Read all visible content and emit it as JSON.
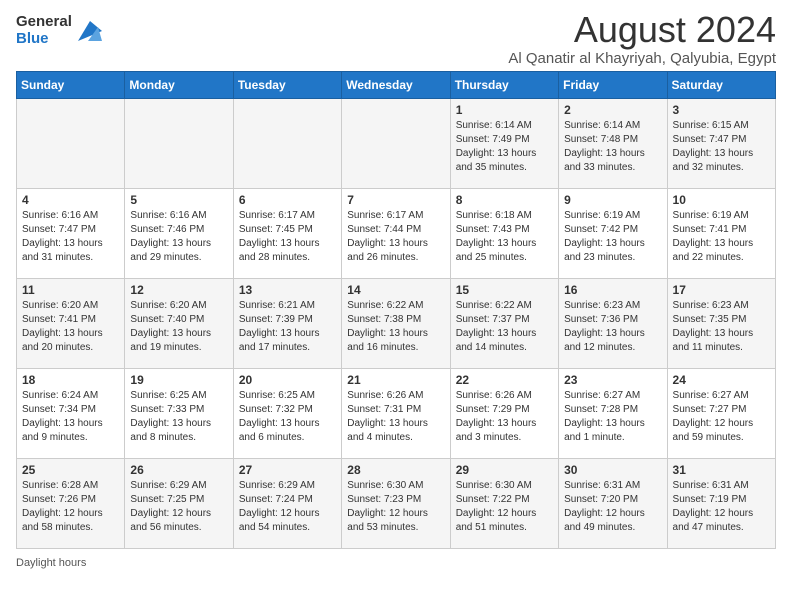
{
  "logo": {
    "general": "General",
    "blue": "Blue"
  },
  "header": {
    "month": "August 2024",
    "location": "Al Qanatir al Khayriyah, Qalyubia, Egypt"
  },
  "days_of_week": [
    "Sunday",
    "Monday",
    "Tuesday",
    "Wednesday",
    "Thursday",
    "Friday",
    "Saturday"
  ],
  "weeks": [
    [
      {
        "day": "",
        "info": ""
      },
      {
        "day": "",
        "info": ""
      },
      {
        "day": "",
        "info": ""
      },
      {
        "day": "",
        "info": ""
      },
      {
        "day": "1",
        "info": "Sunrise: 6:14 AM\nSunset: 7:49 PM\nDaylight: 13 hours and 35 minutes."
      },
      {
        "day": "2",
        "info": "Sunrise: 6:14 AM\nSunset: 7:48 PM\nDaylight: 13 hours and 33 minutes."
      },
      {
        "day": "3",
        "info": "Sunrise: 6:15 AM\nSunset: 7:47 PM\nDaylight: 13 hours and 32 minutes."
      }
    ],
    [
      {
        "day": "4",
        "info": "Sunrise: 6:16 AM\nSunset: 7:47 PM\nDaylight: 13 hours and 31 minutes."
      },
      {
        "day": "5",
        "info": "Sunrise: 6:16 AM\nSunset: 7:46 PM\nDaylight: 13 hours and 29 minutes."
      },
      {
        "day": "6",
        "info": "Sunrise: 6:17 AM\nSunset: 7:45 PM\nDaylight: 13 hours and 28 minutes."
      },
      {
        "day": "7",
        "info": "Sunrise: 6:17 AM\nSunset: 7:44 PM\nDaylight: 13 hours and 26 minutes."
      },
      {
        "day": "8",
        "info": "Sunrise: 6:18 AM\nSunset: 7:43 PM\nDaylight: 13 hours and 25 minutes."
      },
      {
        "day": "9",
        "info": "Sunrise: 6:19 AM\nSunset: 7:42 PM\nDaylight: 13 hours and 23 minutes."
      },
      {
        "day": "10",
        "info": "Sunrise: 6:19 AM\nSunset: 7:41 PM\nDaylight: 13 hours and 22 minutes."
      }
    ],
    [
      {
        "day": "11",
        "info": "Sunrise: 6:20 AM\nSunset: 7:41 PM\nDaylight: 13 hours and 20 minutes."
      },
      {
        "day": "12",
        "info": "Sunrise: 6:20 AM\nSunset: 7:40 PM\nDaylight: 13 hours and 19 minutes."
      },
      {
        "day": "13",
        "info": "Sunrise: 6:21 AM\nSunset: 7:39 PM\nDaylight: 13 hours and 17 minutes."
      },
      {
        "day": "14",
        "info": "Sunrise: 6:22 AM\nSunset: 7:38 PM\nDaylight: 13 hours and 16 minutes."
      },
      {
        "day": "15",
        "info": "Sunrise: 6:22 AM\nSunset: 7:37 PM\nDaylight: 13 hours and 14 minutes."
      },
      {
        "day": "16",
        "info": "Sunrise: 6:23 AM\nSunset: 7:36 PM\nDaylight: 13 hours and 12 minutes."
      },
      {
        "day": "17",
        "info": "Sunrise: 6:23 AM\nSunset: 7:35 PM\nDaylight: 13 hours and 11 minutes."
      }
    ],
    [
      {
        "day": "18",
        "info": "Sunrise: 6:24 AM\nSunset: 7:34 PM\nDaylight: 13 hours and 9 minutes."
      },
      {
        "day": "19",
        "info": "Sunrise: 6:25 AM\nSunset: 7:33 PM\nDaylight: 13 hours and 8 minutes."
      },
      {
        "day": "20",
        "info": "Sunrise: 6:25 AM\nSunset: 7:32 PM\nDaylight: 13 hours and 6 minutes."
      },
      {
        "day": "21",
        "info": "Sunrise: 6:26 AM\nSunset: 7:31 PM\nDaylight: 13 hours and 4 minutes."
      },
      {
        "day": "22",
        "info": "Sunrise: 6:26 AM\nSunset: 7:29 PM\nDaylight: 13 hours and 3 minutes."
      },
      {
        "day": "23",
        "info": "Sunrise: 6:27 AM\nSunset: 7:28 PM\nDaylight: 13 hours and 1 minute."
      },
      {
        "day": "24",
        "info": "Sunrise: 6:27 AM\nSunset: 7:27 PM\nDaylight: 12 hours and 59 minutes."
      }
    ],
    [
      {
        "day": "25",
        "info": "Sunrise: 6:28 AM\nSunset: 7:26 PM\nDaylight: 12 hours and 58 minutes."
      },
      {
        "day": "26",
        "info": "Sunrise: 6:29 AM\nSunset: 7:25 PM\nDaylight: 12 hours and 56 minutes."
      },
      {
        "day": "27",
        "info": "Sunrise: 6:29 AM\nSunset: 7:24 PM\nDaylight: 12 hours and 54 minutes."
      },
      {
        "day": "28",
        "info": "Sunrise: 6:30 AM\nSunset: 7:23 PM\nDaylight: 12 hours and 53 minutes."
      },
      {
        "day": "29",
        "info": "Sunrise: 6:30 AM\nSunset: 7:22 PM\nDaylight: 12 hours and 51 minutes."
      },
      {
        "day": "30",
        "info": "Sunrise: 6:31 AM\nSunset: 7:20 PM\nDaylight: 12 hours and 49 minutes."
      },
      {
        "day": "31",
        "info": "Sunrise: 6:31 AM\nSunset: 7:19 PM\nDaylight: 12 hours and 47 minutes."
      }
    ]
  ],
  "footer": {
    "label": "Daylight hours"
  }
}
